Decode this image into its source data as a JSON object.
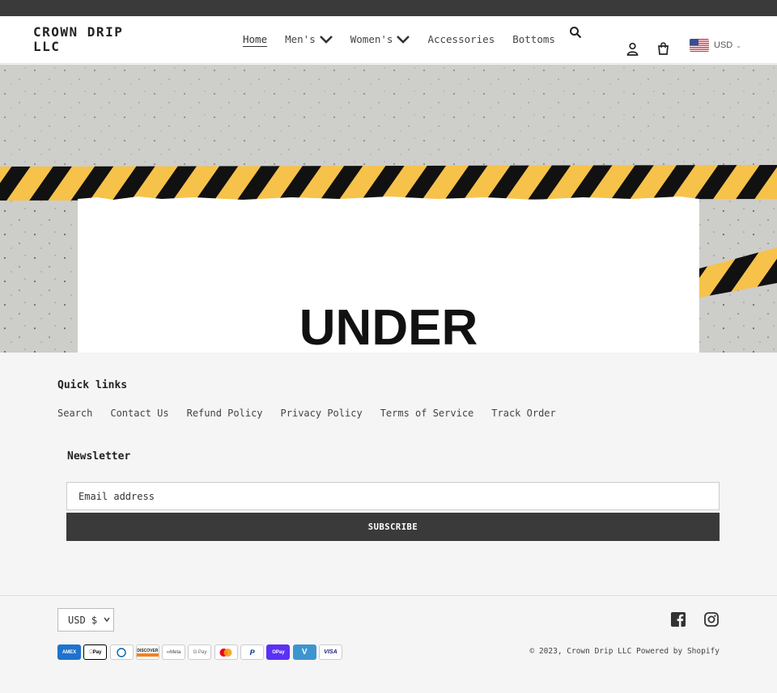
{
  "store": {
    "name": "CROWN DRIP LLC"
  },
  "nav": {
    "items": [
      {
        "label": "Home",
        "active": true,
        "dropdown": false
      },
      {
        "label": "Men's",
        "active": false,
        "dropdown": true
      },
      {
        "label": "Women's",
        "active": false,
        "dropdown": true
      },
      {
        "label": "Accessories",
        "active": false,
        "dropdown": false
      },
      {
        "label": "Bottoms",
        "active": false,
        "dropdown": false
      }
    ]
  },
  "header_icons": [
    "search-icon",
    "account-icon",
    "cart-icon"
  ],
  "currency": {
    "code": "USD",
    "flag": "us-flag-icon"
  },
  "hero": {
    "text": "UNDER",
    "tape_color": "#f6c24a",
    "stripe_color": "#111111"
  },
  "footer": {
    "quick_links_title": "Quick links",
    "links": [
      "Search",
      "Contact Us",
      "Refund Policy",
      "Privacy Policy",
      "Terms of Service",
      "Track Order"
    ],
    "newsletter_title": "Newsletter",
    "email_placeholder": "Email address",
    "subscribe_label": "SUBSCRIBE",
    "currency_select": "USD $",
    "social": [
      "facebook-icon",
      "instagram-icon"
    ],
    "payments": [
      "American Express",
      "Apple Pay",
      "Diners Club",
      "Discover",
      "Meta Pay",
      "Google Pay",
      "Mastercard",
      "PayPal",
      "Shop Pay",
      "Venmo",
      "Visa"
    ],
    "copyright": "© 2023, Crown Drip LLC Powered by Shopify"
  },
  "colors": {
    "accent": "#3a3a3a",
    "background": "#f5f5f5",
    "tape": "#f6c24a"
  }
}
